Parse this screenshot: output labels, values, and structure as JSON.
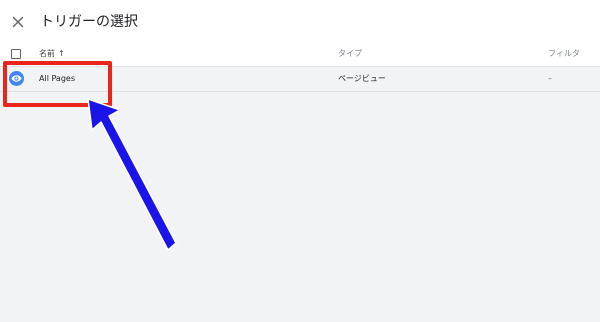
{
  "dialog": {
    "title": "トリガーの選択",
    "close_icon": "close-icon"
  },
  "table": {
    "columns": {
      "name": "名前",
      "type": "タイプ",
      "filter": "フィルタ"
    },
    "sort_icon": "arrow-up-icon",
    "rows": [
      {
        "name": "All Pages",
        "type": "ページビュー",
        "filter": "–",
        "icon": "eye-icon"
      }
    ]
  },
  "colors": {
    "accent_blue": "#4285f4",
    "highlight_red": "#e8261c",
    "annotation_arrow": "#1a14e8",
    "row_background": "#f2f3f5"
  }
}
